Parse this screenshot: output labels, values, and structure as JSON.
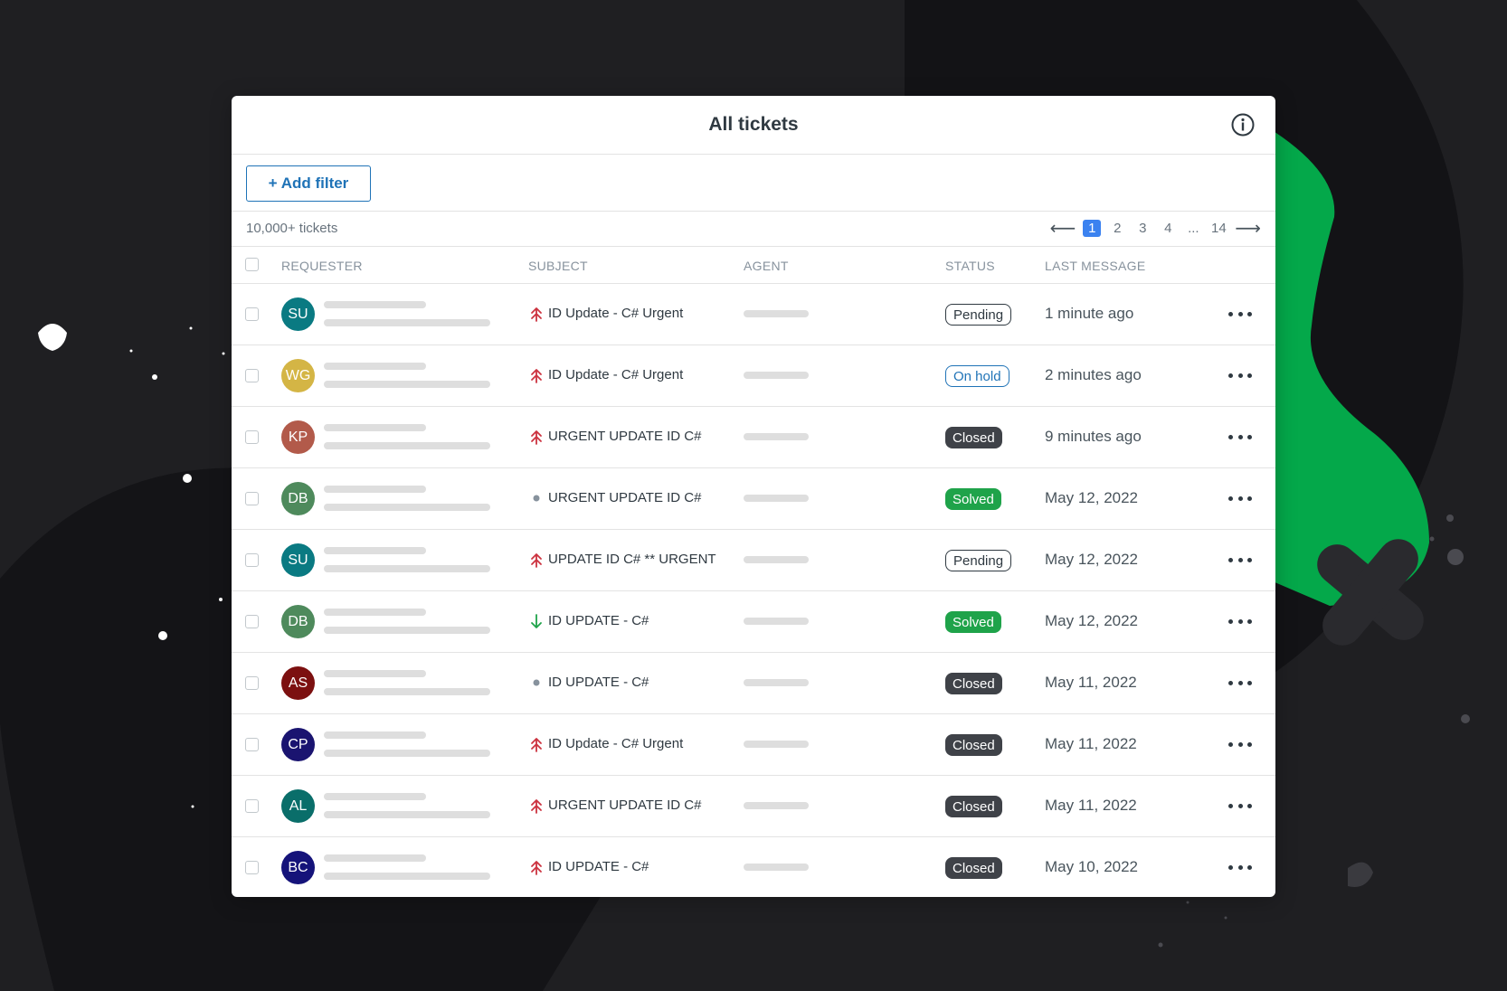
{
  "page": {
    "title": "All tickets",
    "add_filter_label": "+ Add filter",
    "ticket_count": "10,000+ tickets"
  },
  "pagination": {
    "prev": "⟵",
    "pages": [
      "1",
      "2",
      "3",
      "4"
    ],
    "ellipsis": "...",
    "last": "14",
    "next": "⟶",
    "active": "1"
  },
  "columns": {
    "requester": "REQUESTER",
    "subject": "SUBJECT",
    "agent": "AGENT",
    "status": "STATUS",
    "last_message": "LAST MESSAGE"
  },
  "colors": {
    "accent": "#1f73b7",
    "urgent": "#cc3340",
    "low": "#1fa34a",
    "closed": "#3f4248",
    "solved": "#1fa34a",
    "background_green": "#04a84a"
  },
  "tickets": [
    {
      "initials": "SU",
      "avatar_color": "#0a7a82",
      "priority": "urgent",
      "subject": "ID Update - C# Urgent",
      "status": "Pending",
      "status_kind": "pending",
      "last_message": "1 minute ago"
    },
    {
      "initials": "WG",
      "avatar_color": "#d4b545",
      "priority": "urgent",
      "subject": "ID Update - C# Urgent",
      "status": "On hold",
      "status_kind": "hold",
      "last_message": "2 minutes ago"
    },
    {
      "initials": "KP",
      "avatar_color": "#b25a4a",
      "priority": "urgent",
      "subject": "URGENT UPDATE ID C#",
      "status": "Closed",
      "status_kind": "closed",
      "last_message": "9 minutes ago"
    },
    {
      "initials": "DB",
      "avatar_color": "#4e8a5c",
      "priority": "normal",
      "subject": "URGENT UPDATE ID C#",
      "status": "Solved",
      "status_kind": "solved",
      "last_message": "May 12, 2022"
    },
    {
      "initials": "SU",
      "avatar_color": "#0a7a82",
      "priority": "urgent",
      "subject": "UPDATE ID C# ** URGENT",
      "status": "Pending",
      "status_kind": "pending",
      "last_message": "May 12, 2022"
    },
    {
      "initials": "DB",
      "avatar_color": "#4e8a5c",
      "priority": "low",
      "subject": "ID UPDATE - C#",
      "status": "Solved",
      "status_kind": "solved",
      "last_message": "May 12, 2022"
    },
    {
      "initials": "AS",
      "avatar_color": "#7c1010",
      "priority": "normal",
      "subject": "ID UPDATE - C#",
      "status": "Closed",
      "status_kind": "closed",
      "last_message": "May 11, 2022"
    },
    {
      "initials": "CP",
      "avatar_color": "#1a1470",
      "priority": "urgent",
      "subject": "ID Update - C# Urgent",
      "status": "Closed",
      "status_kind": "closed",
      "last_message": "May 11, 2022"
    },
    {
      "initials": "AL",
      "avatar_color": "#0a6e6a",
      "priority": "urgent",
      "subject": "URGENT UPDATE ID C#",
      "status": "Closed",
      "status_kind": "closed",
      "last_message": "May 11, 2022"
    },
    {
      "initials": "BC",
      "avatar_color": "#15137a",
      "priority": "urgent",
      "subject": "ID UPDATE - C#",
      "status": "Closed",
      "status_kind": "closed",
      "last_message": "May 10, 2022"
    }
  ]
}
